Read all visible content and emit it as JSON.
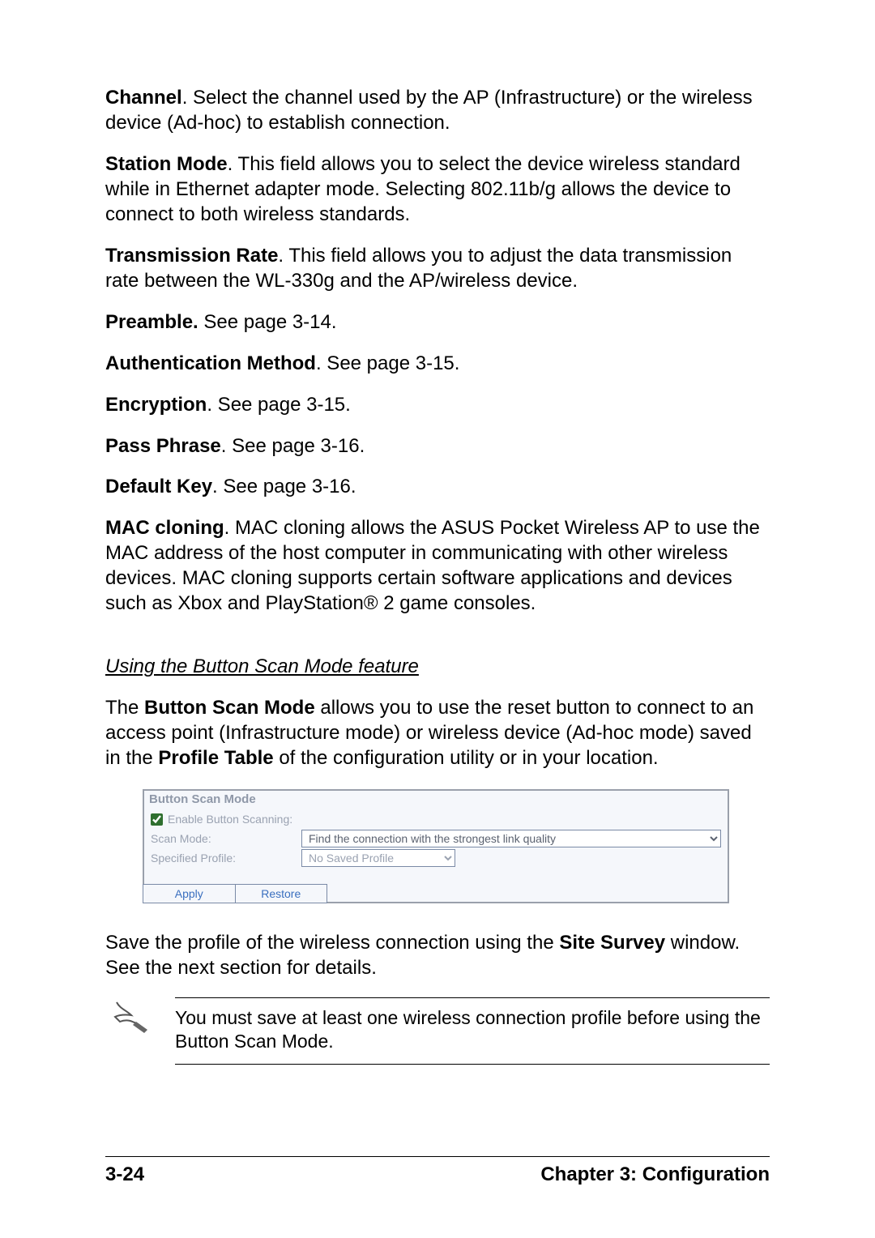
{
  "paragraphs": {
    "channel": {
      "term": "Channel",
      "text": ". Select the channel used by the AP (Infrastructure) or the wireless device (Ad-hoc) to establish connection."
    },
    "station": {
      "term": "Station Mode",
      "text": ". This field allows you to select the device wireless standard while in Ethernet adapter mode. Selecting 802.11b/g allows the device to connect to both wireless standards."
    },
    "txrate": {
      "term": "Transmission Rate",
      "text": ". This field allows you to adjust the data transmission rate between the WL-330g and the AP/wireless device."
    },
    "preamble": {
      "term": "Preamble.",
      "text": " See page 3-14."
    },
    "auth": {
      "term": "Authentication Method",
      "text": ". See page 3-15."
    },
    "enc": {
      "term": "Encryption",
      "text": ". See page 3-15."
    },
    "pass": {
      "term": "Pass Phrase",
      "text": ". See page 3-16."
    },
    "defkey": {
      "term": "Default Key",
      "text": ". See page 3-16."
    },
    "mac": {
      "term": "MAC cloning",
      "text": ". MAC cloning allows the ASUS Pocket Wireless AP to use the MAC address of the host computer in communicating with other wireless devices. MAC cloning supports certain software applications and devices such as Xbox and PlayStation® 2 game consoles."
    }
  },
  "subheading": "Using the Button Scan Mode feature",
  "bsm_intro": {
    "pre": "The ",
    "term1": "Button Scan Mode",
    "mid": " allows you to use the reset button to connect to an access point (Infrastructure mode) or wireless device (Ad-hoc mode) saved in the ",
    "term2": "Profile Table",
    "post": " of the configuration utility or in your location."
  },
  "panel": {
    "title": "Button Scan Mode",
    "enable_label": "Enable Button Scanning:",
    "scan_mode_label": "Scan Mode:",
    "scan_mode_value": "Find the connection with the strongest link quality",
    "profile_label": "Specified Profile:",
    "profile_value": "No Saved Profile",
    "apply": "Apply",
    "restore": "Restore"
  },
  "after_panel": {
    "pre": "Save the profile of the wireless connection using the ",
    "term": "Site Survey",
    "post": " window. See the next section for details."
  },
  "note_text": "You must save at least one wireless connection profile before using the Button Scan Mode.",
  "footer": {
    "page": "3-24",
    "chapter": "Chapter 3: Configuration"
  }
}
